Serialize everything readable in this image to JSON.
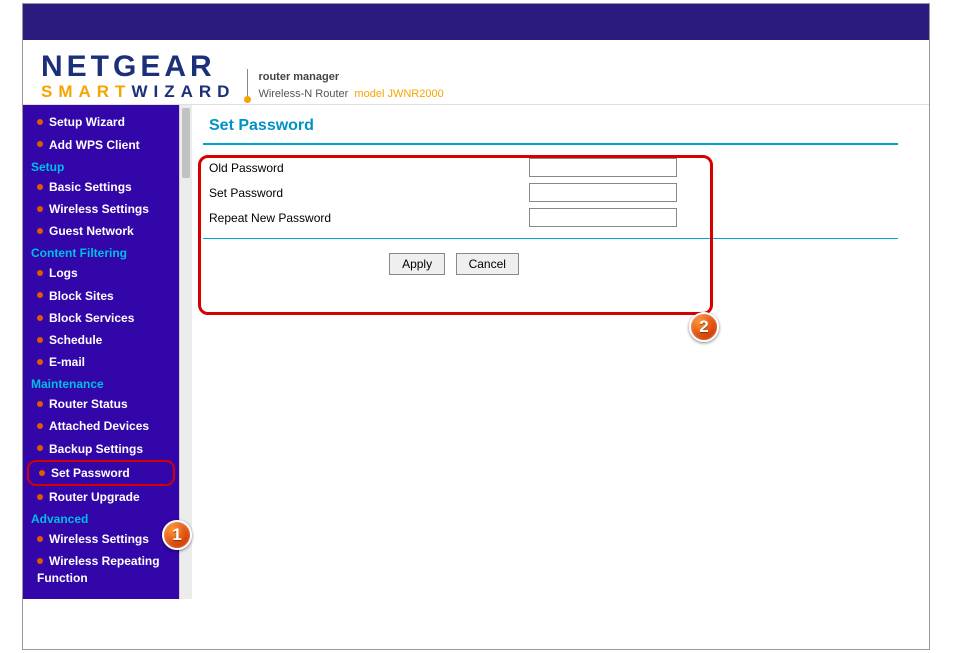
{
  "header": {
    "brand": "NETGEAR",
    "smart": "SMART",
    "wizard": "WIZARD",
    "tagline1": "router manager",
    "tagline2_prefix": "Wireless-N Router",
    "tagline2_model_label": "model",
    "tagline2_model": "JWNR2000"
  },
  "sidebar": {
    "setup_wizard": "Setup Wizard",
    "add_wps": "Add WPS Client",
    "section_setup": "Setup",
    "basic": "Basic Settings",
    "wireless": "Wireless Settings",
    "guest": "Guest Network",
    "section_filter": "Content Filtering",
    "logs": "Logs",
    "block_sites": "Block Sites",
    "block_services": "Block Services",
    "schedule": "Schedule",
    "email": "E-mail",
    "section_maint": "Maintenance",
    "router_status": "Router Status",
    "attached": "Attached Devices",
    "backup": "Backup Settings",
    "set_password": "Set Password",
    "upgrade": "Router Upgrade",
    "section_adv": "Advanced",
    "adv_wireless": "Wireless Settings",
    "wrf": "Wireless Repeating Function"
  },
  "form": {
    "title": "Set Password",
    "old_pass": "Old Password",
    "new_pass": "Set Password",
    "repeat_pass": "Repeat New Password",
    "apply": "Apply",
    "cancel": "Cancel"
  },
  "annotations": {
    "badge1": "1",
    "badge2": "2"
  }
}
